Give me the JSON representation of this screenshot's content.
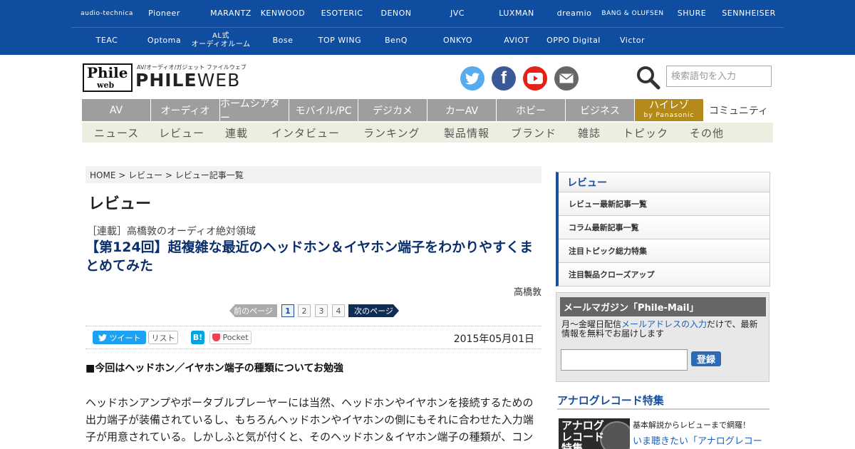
{
  "brands": {
    "row1": [
      "audio-technica",
      "Pioneer",
      "MARANTZ",
      "KENWOOD",
      "ESOTERIC",
      "DENON",
      "JVC",
      "LUXMAN",
      "dreamio",
      "BANG & OLUFSEN",
      "SHURE",
      "SENNHEISER"
    ],
    "row2": [
      "TEAC",
      "Optoma",
      "AL式\nオーディオルーム",
      "Bose",
      "TOP WING",
      "BenQ",
      "ONKYO",
      "AVIOT",
      "OPPO Digital",
      "Victor"
    ]
  },
  "header": {
    "logo_sub": "AV/オーディオ/ガジェット ファイルウェブ",
    "logo_phile": "Phile",
    "logo_web": "web",
    "logo_main_bold": "PHILE",
    "logo_main_light": "WEB",
    "search_placeholder": "検索語句を入力",
    "social": [
      {
        "name": "twitter",
        "color": "#55acee"
      },
      {
        "name": "facebook",
        "color": "#3b5998"
      },
      {
        "name": "youtube",
        "color": "#e62117"
      },
      {
        "name": "mail",
        "color": "#666666"
      }
    ]
  },
  "nav": {
    "main": [
      "AV",
      "オーディオ",
      "ホームシアター",
      "モバイル/PC",
      "デジカメ",
      "カーAV",
      "ホビー",
      "ビジネス"
    ],
    "hires_label": "ハイレゾ",
    "hires_sub": "by Panasonic",
    "community": "コミュニティ",
    "sub": [
      "ニュース",
      "レビュー",
      "連載",
      "インタビュー",
      "ランキング",
      "製品情報",
      "ブランド",
      "雑誌",
      "トピック",
      "その他"
    ]
  },
  "breadcrumb": "HOME > レビュー > レビュー記事一覧",
  "article": {
    "category_title": "レビュー",
    "series": "［連載］高橋敦のオーディオ絶対領域",
    "headline": "【第124回】超複雑な最近のヘッドホン＆イヤホン端子をわかりやすくまとめてみた",
    "author": "高橋敦",
    "pager": {
      "prev": "前のページ",
      "pages": [
        "1",
        "2",
        "3",
        "4"
      ],
      "current": "1",
      "next": "次のページ"
    },
    "share": {
      "tweet": "ツイート",
      "list": "リスト",
      "hatena": "B!",
      "pocket": "Pocket"
    },
    "date": "2015年05月01日",
    "section_heading": "■今回はヘッドホン／イヤホン端子の種類についてお勉強",
    "body": "ヘッドホンアンプやポータブルプレーヤーには当然、ヘッドホンやイヤホンを接続するための出力端子が装備されているし、もちろんヘッドホンやイヤホンの側にもそれに合わせた入力端子が用意されている。しかしふと気が付くと、そのヘッドホン＆イヤホン端子の種類が、コン"
  },
  "sidebar": {
    "menu_title": "レビュー",
    "menu_items": [
      "レビュー最新記事一覧",
      "コラム最新記事一覧",
      "注目トピック総力特集",
      "注目製品クローズアップ"
    ],
    "mail": {
      "title": "メールマガジン「Phile-Mail」",
      "desc_before": "月～金曜日配信",
      "desc_link": "メールアドレスの入力",
      "desc_after": "だけで、最新情報を無料でお届けします",
      "button": "登録"
    },
    "analog": {
      "heading": "アナログレコード特集",
      "thumb_text": "アナログレコード特集",
      "sub": "基本解説からレビューまで網羅！",
      "link": "いま聴きたい「アナログレコー"
    }
  }
}
